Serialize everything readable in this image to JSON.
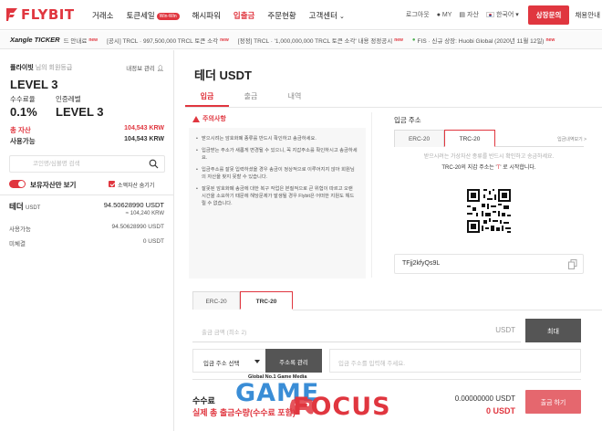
{
  "brand": {
    "name": "FLYBIT",
    "accent": "#e0363f"
  },
  "nav": {
    "menu": [
      {
        "label": "거래소",
        "badge": "",
        "caret": false,
        "active": false
      },
      {
        "label": "토큰세일",
        "badge": "Win-Win",
        "caret": false,
        "active": false
      },
      {
        "label": "해시파워",
        "badge": "",
        "caret": false,
        "active": false
      },
      {
        "label": "입출금",
        "badge": "",
        "caret": false,
        "active": true
      },
      {
        "label": "주문현황",
        "badge": "",
        "caret": false,
        "active": false
      },
      {
        "label": "고객센터",
        "badge": "",
        "caret": true,
        "active": false
      }
    ],
    "logout": "로그아웃",
    "my": "MY",
    "assets": "자산",
    "language": "한국어",
    "consult_button": "상장문의",
    "recruit": "채용안내"
  },
  "ticker": {
    "label": "Xangle TICKER",
    "items": [
      {
        "text": "드 안내료",
        "new": "new"
      },
      {
        "text": "[공시] TRCL · 997,500,000 TRCL 토큰 소각",
        "new": "new"
      },
      {
        "text": "[정정] TRCL · '1,000,000,000 TRCL 토큰 소각' 내용 정정공시",
        "new": "new"
      },
      {
        "text": "FIS · 신규 상장: Huobi Global (2020년 11월 12일)",
        "new": "new"
      }
    ]
  },
  "sidebar": {
    "member_name": "플라이빗",
    "member_suffix": "님의 회원등급",
    "info_link": "내정보 관리",
    "level": "LEVEL 3",
    "fee_label": "수수료율",
    "auth_label": "인증레벨",
    "fee_value": "0.1%",
    "auth_value": "LEVEL 3",
    "total_label": "총 자산",
    "total_value": "104,543 KRW",
    "avail_label": "사용가능",
    "avail_value": "104,543 KRW",
    "search_placeholder": "코인명/심볼명 검색",
    "toggle_label": "보유자산만 보기",
    "small_label": "소액자산 숨기기",
    "coin": {
      "name": "테더",
      "symbol": "USDT",
      "amount": "94.50628990 USDT",
      "krw": "≈ 104,240 KRW",
      "rows": [
        {
          "label": "사용가능",
          "value": "94.50628990 USDT"
        },
        {
          "label": "미체결",
          "value": "0 USDT"
        }
      ]
    }
  },
  "main": {
    "title": "테더 USDT",
    "tabs": [
      "입금",
      "출금",
      "내역"
    ],
    "notice": {
      "title": "주의사항",
      "items": [
        "받으시려는 암호화폐 종류를 반드시 확인하고 송금하세요.",
        "입금받는 주소가 새롭게 변경될 수 있으니, 꼭 지갑주소를 확인하시고 송금하세요.",
        "입금주소를 잘못 입력하셨을 경우 송금이 정상적으로 이루어지지 않아 회원님의 자산을 찾지 못할 수 있습니다.",
        "잘못된 암호화폐 송금에 대한 복구 작업은 본질적으로 큰 위험이 따르고 오랜 시간을 소요하기 때문에 해당문제가 발생될 경우 Flybit은 어떠한 지원도 해드릴 수 없습니다."
      ]
    },
    "deposit": {
      "title": "입금 주소",
      "tabs": [
        "ERC-20",
        "TRC-20"
      ],
      "history_link": "입금내역보기 >",
      "note1": "받으시려는 가상자산 종류를 반드시 확인하고 송금하세요.",
      "note2_prefix": "TRC-20의 지갑 주소는 '",
      "note2_red": "T",
      "note2_suffix": "' 로 시작합니다.",
      "address": "TFjj2kfyQs9L"
    },
    "withdraw": {
      "tabs": [
        "ERC-20",
        "TRC-20"
      ],
      "amount_placeholder": "출금 금액 (최소 2)",
      "amount_unit": "USDT",
      "max_button": "최대",
      "select_label": "입금 주소 선택",
      "book_button": "주소록 관리",
      "address_placeholder": "입금 주소를 입력해 주세요.",
      "fee_label": "수수료",
      "fee_value": "0.00000000 USDT",
      "total_label": "실제 총 출금수량(수수료 포함)",
      "total_value": "0 USDT",
      "submit_button": "출금 하기"
    }
  },
  "watermark": {
    "tagline": "Global No.1 Game Media",
    "word1": "GAME",
    "word2": "FOCUS"
  }
}
